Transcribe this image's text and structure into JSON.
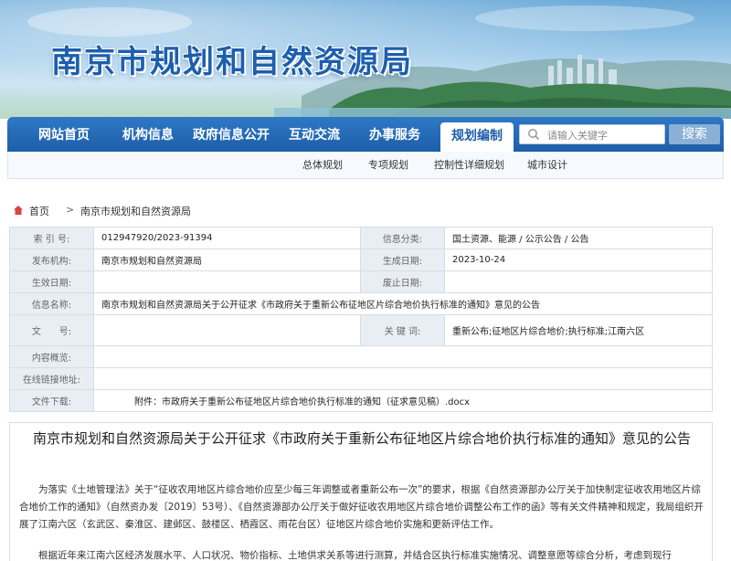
{
  "banner": {
    "title": "南京市规划和自然资源局"
  },
  "nav": {
    "items": [
      {
        "label": "网站首页"
      },
      {
        "label": "机构信息"
      },
      {
        "label": "政府信息公开"
      },
      {
        "label": "互动交流"
      },
      {
        "label": "办事服务"
      },
      {
        "label": "规划编制",
        "active": true
      }
    ],
    "search_placeholder": "请输入关键字",
    "search_button": "搜索"
  },
  "subnav": {
    "items": [
      "总体规划",
      "专项规划",
      "控制性详细规划",
      "城市设计"
    ]
  },
  "breadcrumb": {
    "home": "首页",
    "separator": ">",
    "current": "南京市规划和自然资源局"
  },
  "info": {
    "rows": [
      {
        "l1": "索 引 号:",
        "v1": "012947920/2023-91394",
        "l2": "信息分类:",
        "v2": "国土资源、能源 / 公示公告 / 公告"
      },
      {
        "l1": "发布机构:",
        "v1": "南京市规划和自然资源局",
        "l2": "生成日期:",
        "v2": "2023-10-24"
      },
      {
        "l1": "生效日期:",
        "v1": "",
        "l2": "废止日期:",
        "v2": ""
      },
      {
        "l1": "信息名称:",
        "v1": "南京市规划和自然资源局关于公开征求《市政府关于重新公布征地区片综合地价执行标准的通知》意见的公告"
      },
      {
        "l1": "文　　号:",
        "v1": "",
        "l2": "关 键 词:",
        "v2": "重新公布;征地区片综合地价;执行标准;江南六区"
      },
      {
        "l1": "内容概览:",
        "v1": ""
      },
      {
        "l1": "在线链接地址:",
        "v1": ""
      },
      {
        "l1": "文件下载:",
        "v1": "附件：市政府关于重新公布征地区片综合地价执行标准的通知（征求意见稿）.docx"
      }
    ]
  },
  "article": {
    "title": "南京市规划和自然资源局关于公开征求《市政府关于重新公布征地区片综合地价执行标准的通知》意见的公告",
    "para1": "为落实《土地管理法》关于“征收农用地区片综合地价应至少每三年调整或者重新公布一次”的要求，根据《自然资源部办公厅关于加快制定征收农用地区片综合地价工作的通知》（自然资办发〔2019〕53号）、《自然资源部办公厅关于做好征收农用地区片综合地价调整公布工作的函》等有关文件精神和规定，我局组织开展了江南六区（玄武区、秦淮区、建邺区、鼓楼区、栖霞区、雨花台区）征地区片综合地价实施和更新评估工作。",
    "para2": "根据近年来江南六区经济发展水平、人口状况、物价指标、土地供求关系等进行测算，并结合区执行标准实施情况、调整意愿等综合分析，考虑到现行"
  },
  "colors": {
    "nav_blue": "#1d5ea8",
    "title_blue": "#1c5fae",
    "label_bg": "#e9eef4"
  }
}
